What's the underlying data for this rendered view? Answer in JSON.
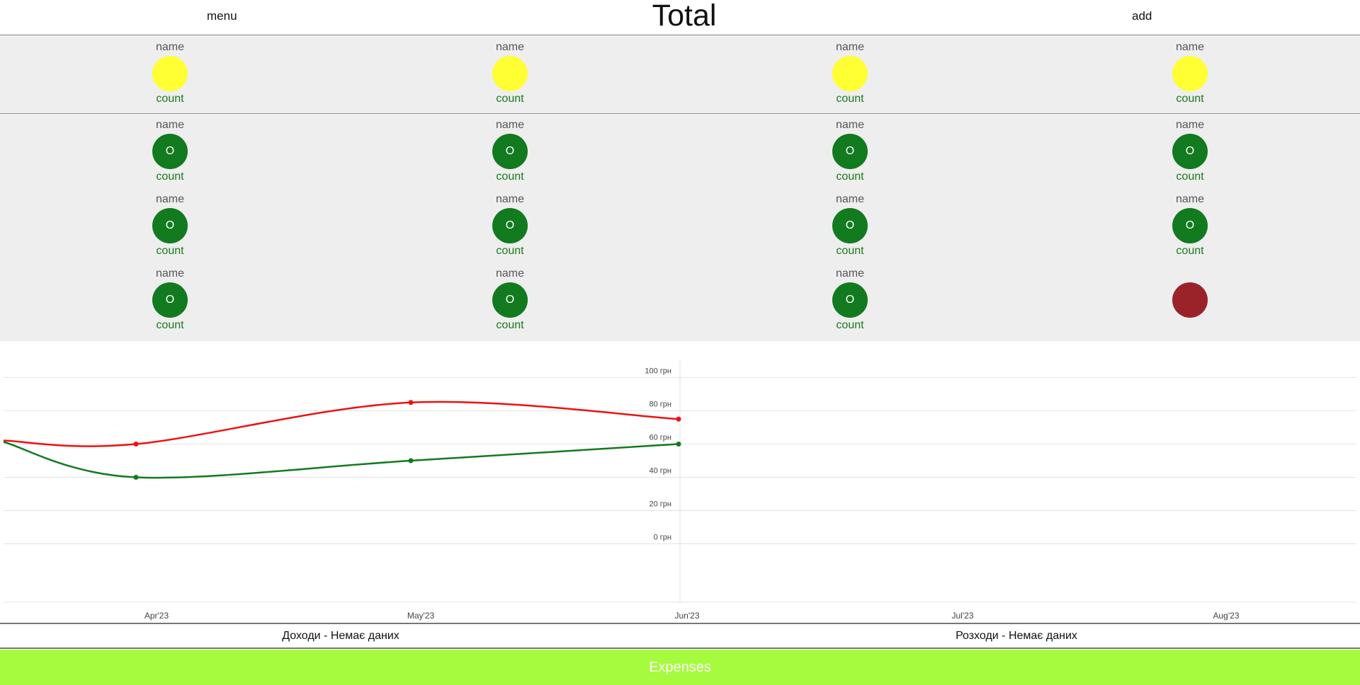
{
  "header": {
    "menu_label": "menu",
    "title": "Total",
    "add_label": "add"
  },
  "accounts": [
    {
      "name": "name",
      "count": "count",
      "icon": "",
      "color": "#ffff33"
    },
    {
      "name": "name",
      "count": "count",
      "icon": "",
      "color": "#ffff33"
    },
    {
      "name": "name",
      "count": "count",
      "icon": "",
      "color": "#ffff33"
    },
    {
      "name": "name",
      "count": "count",
      "icon": "",
      "color": "#ffff33"
    }
  ],
  "categories": [
    {
      "name": "name",
      "count": "count",
      "icon": "O",
      "color": "#127a1f"
    },
    {
      "name": "name",
      "count": "count",
      "icon": "O",
      "color": "#127a1f"
    },
    {
      "name": "name",
      "count": "count",
      "icon": "O",
      "color": "#127a1f"
    },
    {
      "name": "name",
      "count": "count",
      "icon": "O",
      "color": "#127a1f"
    },
    {
      "name": "name",
      "count": "count",
      "icon": "O",
      "color": "#127a1f"
    },
    {
      "name": "name",
      "count": "count",
      "icon": "O",
      "color": "#127a1f"
    },
    {
      "name": "name",
      "count": "count",
      "icon": "O",
      "color": "#127a1f"
    },
    {
      "name": "name",
      "count": "count",
      "icon": "O",
      "color": "#127a1f"
    },
    {
      "name": "name",
      "count": "count",
      "icon": "O",
      "color": "#127a1f"
    },
    {
      "name": "name",
      "count": "count",
      "icon": "O",
      "color": "#127a1f"
    },
    {
      "name": "name",
      "count": "count",
      "icon": "O",
      "color": "#127a1f"
    },
    {
      "name": "",
      "count": "",
      "icon": "",
      "color": "#9a2329"
    }
  ],
  "chart_data": {
    "type": "line",
    "title": "",
    "xlabel": "",
    "ylabel": "",
    "x_ticks": [
      "Apr'23",
      "May'23",
      "Jun'23",
      "Jul'23",
      "Aug'23"
    ],
    "y_ticks": [
      0,
      20,
      40,
      60,
      80,
      100
    ],
    "y_unit": "грн",
    "ylim": [
      -10,
      110
    ],
    "grid": true,
    "series": [
      {
        "color": "#ee1111",
        "x": [
          "Apr'23",
          "May'23",
          "Jun'23"
        ],
        "values": [
          60,
          85,
          75
        ]
      },
      {
        "color": "#127a1f",
        "x": [
          "Apr'23",
          "May'23",
          "Jun'23"
        ],
        "values": [
          40,
          50,
          60
        ]
      }
    ]
  },
  "summary": {
    "income": "Доходи - Немає даних",
    "expenses": "Розходи - Немає даних"
  },
  "footer": {
    "expenses_button": "Expenses"
  }
}
